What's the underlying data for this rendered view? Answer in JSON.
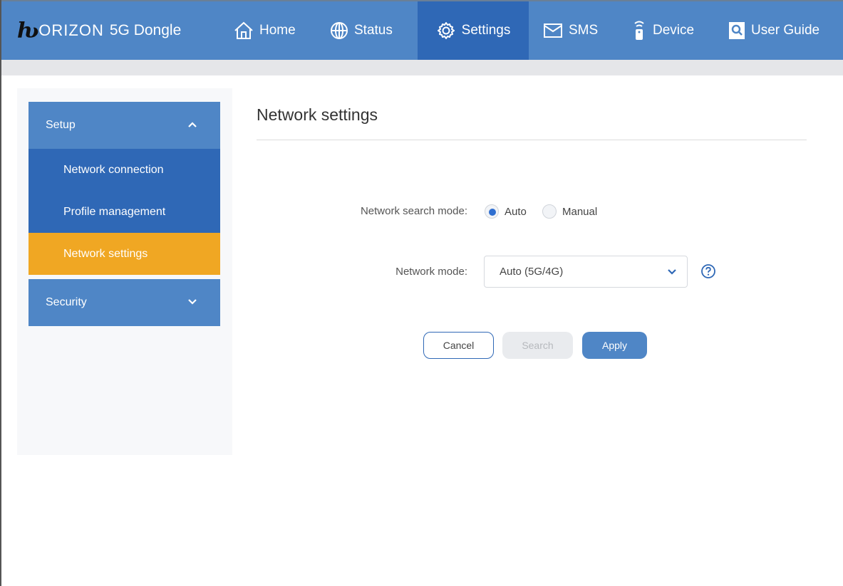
{
  "brand": {
    "mark": "ƕ",
    "name": "ORIZON",
    "product": "5G Dongle"
  },
  "nav": {
    "items": [
      {
        "label": "Home",
        "icon": "home-icon",
        "active": false
      },
      {
        "label": "Status",
        "icon": "globe-icon",
        "active": false
      },
      {
        "label": "Settings",
        "icon": "gear-icon",
        "active": true
      },
      {
        "label": "SMS",
        "icon": "envelope-icon",
        "active": false
      },
      {
        "label": "Device",
        "icon": "device-icon",
        "active": false
      },
      {
        "label": "User Guide",
        "icon": "search-book-icon",
        "active": false
      }
    ]
  },
  "sidebar": {
    "groups": [
      {
        "label": "Setup",
        "expanded": true,
        "items": [
          {
            "label": "Network connection",
            "active": false
          },
          {
            "label": "Profile management",
            "active": false
          },
          {
            "label": "Network settings",
            "active": true
          }
        ]
      },
      {
        "label": "Security",
        "expanded": false,
        "items": []
      }
    ]
  },
  "main": {
    "title": "Network settings",
    "search_mode": {
      "label": "Network search mode:",
      "options": [
        "Auto",
        "Manual"
      ],
      "selected": "Auto"
    },
    "network_mode": {
      "label": "Network mode:",
      "value": "Auto (5G/4G)"
    },
    "buttons": {
      "cancel": "Cancel",
      "search": "Search",
      "apply": "Apply"
    }
  },
  "colors": {
    "topbar": "#4f86c6",
    "active_nav": "#2f68b6",
    "active_sidebar": "#f0a723",
    "radio_selected": "#2f6fd0"
  }
}
